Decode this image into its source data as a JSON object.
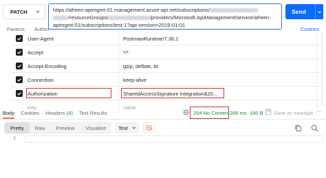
{
  "request": {
    "method": "PATCH",
    "url_line1": "https://afreen-apimgmt-01.management.azure-api.net/subscriptions/",
    "url_line2_a": "/resourceGroups/",
    "url_line2_b": "/providers/Microsoft.ApiManagement/service/afreen-",
    "url_line3": "apimgmt-01/subscriptions/test-1?api-version=2019-01-01",
    "send_label": "Send"
  },
  "request_tabs": {
    "params": "Params",
    "auth": "Author"
  },
  "cookies_link": "Cookies",
  "headers": {
    "rows": [
      {
        "key": "User-Agent",
        "value": "PostmanRuntime/7.36.1"
      },
      {
        "key": "Accept",
        "value": "*/*"
      },
      {
        "key": "Accept-Encoding",
        "value": "gzip, deflate, br"
      },
      {
        "key": "Connection",
        "value": "keep-alive"
      },
      {
        "key": "Authorization",
        "value": "SharedAccessSignature integration&20..."
      }
    ],
    "placeholder_key": "Key",
    "placeholder_value": "Value"
  },
  "response": {
    "tabs": {
      "body": "Body",
      "cookies": "Cookies",
      "headers": "Headers",
      "headers_count": "(4)",
      "test_results": "Test Results"
    },
    "status": "204 No Content",
    "time": "266 ms",
    "size": "180 B",
    "save_example": "Save as example",
    "view_modes": [
      "Pretty",
      "Raw",
      "Preview",
      "Visualize"
    ],
    "format": "Text",
    "line_number": "1"
  },
  "colors": {
    "accent": "#0b6cff",
    "status_green": "#1b8a3a",
    "highlight_red": "#d9332f",
    "tab_underline": "#ff6c37"
  }
}
